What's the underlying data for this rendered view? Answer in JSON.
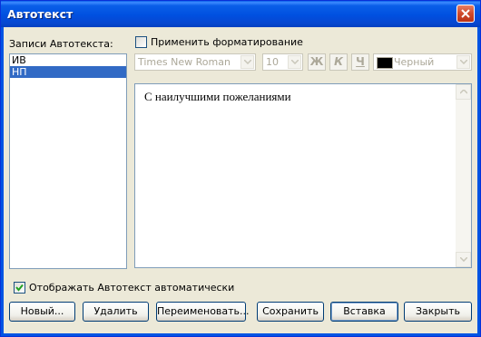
{
  "window": {
    "title": "Автотекст"
  },
  "entries": {
    "label": "Записи Автотекста:",
    "items": [
      "ИВ",
      "НП"
    ],
    "selected_index": 1
  },
  "format": {
    "apply_label": "Применить форматирование",
    "apply_checked": false,
    "font": "Times New Roman",
    "size": "10",
    "bold_glyph": "Ж",
    "italic_glyph": "К",
    "underline_glyph": "Ч",
    "color_label": "Черный",
    "color_swatch": "#000000"
  },
  "preview": {
    "text": "С наилучшими пожеланиями"
  },
  "show_autotext": {
    "label": "Отображать Автотекст автоматически",
    "checked": true
  },
  "buttons": {
    "new": "Новый...",
    "delete": "Удалить",
    "rename": "Переименовать...",
    "save": "Сохранить",
    "insert": "Вставка",
    "close": "Закрыть"
  }
}
